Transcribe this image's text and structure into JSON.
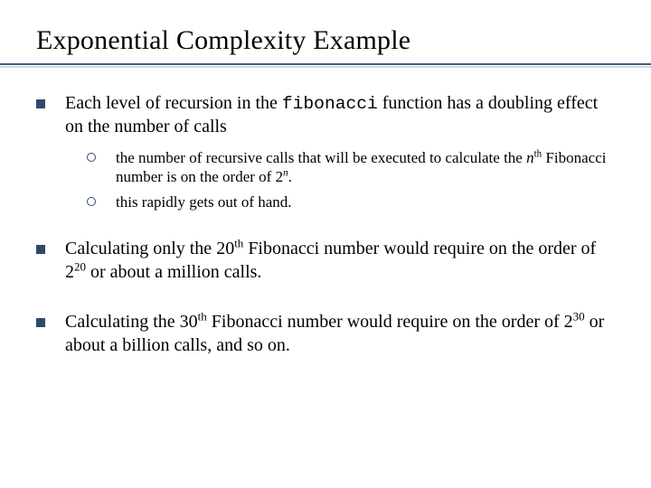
{
  "title": "Exponential Complexity Example",
  "bullets": [
    {
      "pre": "Each level of recursion in the ",
      "code": "fibonacci",
      "post": " function has a doubling effect on the number of calls",
      "subs": [
        {
          "a": "the number of recursive calls that will be executed to calculate the ",
          "b": "n",
          "c": "th",
          "d": " Fibonacci number is on the order of ",
          "e": "2",
          "f": "n",
          "g": "."
        },
        {
          "text": "this rapidly gets out of hand."
        }
      ]
    },
    {
      "a": "Calculating only the 20",
      "b": "th",
      "c": " Fibonacci number would require on the order of 2",
      "d": "20",
      "e": " or about a million calls."
    },
    {
      "a": "Calculating the 30",
      "b": "th",
      "c": " Fibonacci number would require on the order of 2",
      "d": "30",
      "e": " or about a billion calls, and so on."
    }
  ]
}
